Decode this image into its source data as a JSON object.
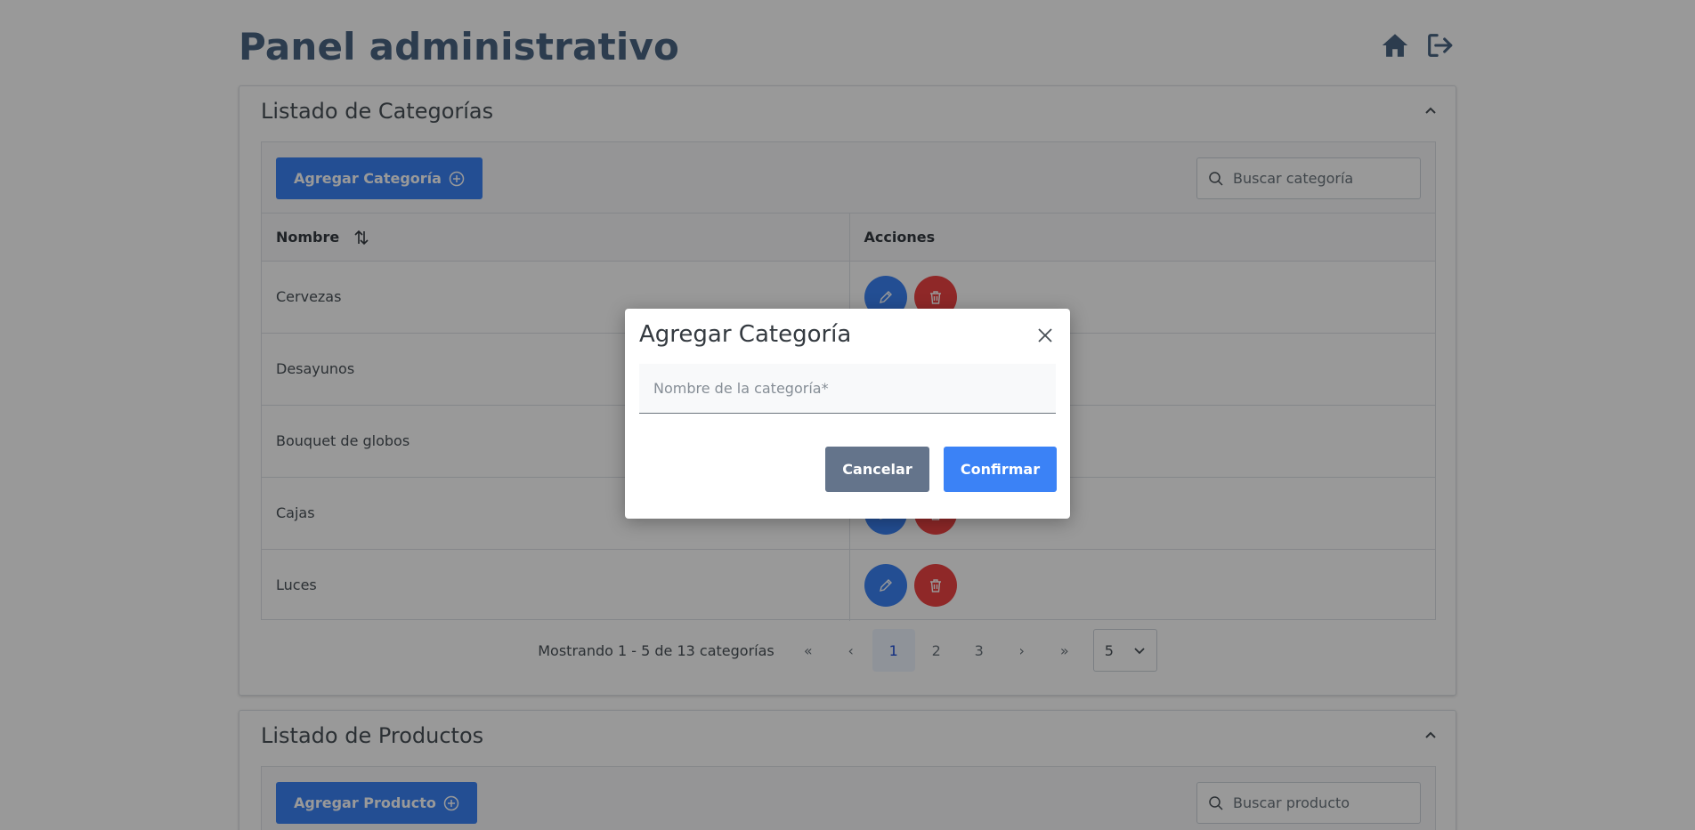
{
  "page": {
    "title": "Panel administrativo"
  },
  "header_icons": {
    "home": "home-icon",
    "logout": "logout-icon"
  },
  "categories_panel": {
    "title": "Listado de Categorías",
    "add_button": "Agregar Categoría",
    "search_placeholder": "Buscar categoría",
    "columns": {
      "name": "Nombre",
      "actions": "Acciones"
    },
    "rows": [
      "Cervezas",
      "Desayunos",
      "Bouquet de globos",
      "Cajas",
      "Luces"
    ],
    "paginator": {
      "report": "Mostrando 1 - 5 de 13 categorías",
      "first": "«",
      "prev": "‹",
      "pages": [
        "1",
        "2",
        "3"
      ],
      "current_page": "1",
      "next": "›",
      "last": "»",
      "rows_per_page": "5"
    }
  },
  "products_panel": {
    "title": "Listado de Productos",
    "add_button": "Agregar Producto",
    "search_placeholder": "Buscar producto"
  },
  "dialog": {
    "title": "Agregar Categoría",
    "input_placeholder": "Nombre de la categoría*",
    "input_value": "",
    "cancel_label": "Cancelar",
    "confirm_label": "Confirmar"
  },
  "colors": {
    "primary": "#3b82f6",
    "danger": "#ef4444",
    "secondary": "#64748b",
    "title": "#4a6582"
  }
}
